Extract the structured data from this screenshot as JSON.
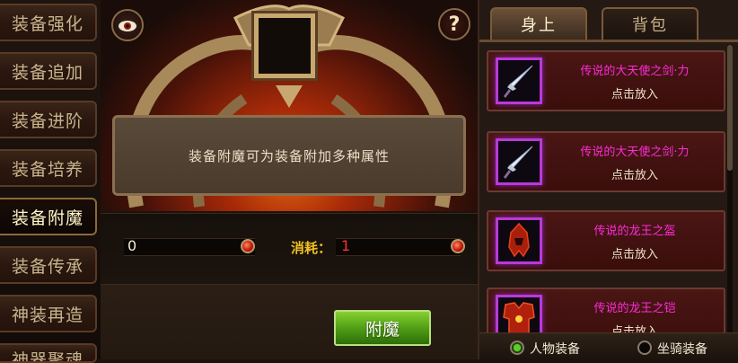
{
  "menu": {
    "items": [
      {
        "label": "装备强化",
        "active": false
      },
      {
        "label": "装备追加",
        "active": false
      },
      {
        "label": "装备进阶",
        "active": false
      },
      {
        "label": "装备培养",
        "active": false
      },
      {
        "label": "装备附魔",
        "active": true
      },
      {
        "label": "装备传承",
        "active": false
      },
      {
        "label": "神装再造",
        "active": false
      },
      {
        "label": "神器聚魂",
        "active": false
      }
    ]
  },
  "center": {
    "description": "装备附魔可为装备附加多种属性",
    "help_label": "?",
    "owned_count": "0",
    "cost_label": "消耗：",
    "cost_value": "1",
    "enchant_button": "附魔"
  },
  "right": {
    "tabs": [
      {
        "label": "身上",
        "active": true
      },
      {
        "label": "背包",
        "active": false
      }
    ],
    "items": [
      {
        "name": "传说的大天使之剑·力",
        "action": "点击放入",
        "icon": "sword-icon"
      },
      {
        "name": "传说的大天使之剑·力",
        "action": "点击放入",
        "icon": "sword-icon"
      },
      {
        "name": "传说的龙王之盔",
        "action": "点击放入",
        "icon": "helmet-icon"
      },
      {
        "name": "传说的龙王之铠",
        "action": "点击放入",
        "icon": "armor-icon"
      }
    ],
    "filters": [
      {
        "label": "人物装备",
        "selected": true
      },
      {
        "label": "坐骑装备",
        "selected": false
      }
    ]
  },
  "colors": {
    "item_name": "#ff2ad8",
    "cost_value": "#ff3030",
    "cost_label": "#f0c020",
    "button_green": "#4c9a14"
  }
}
